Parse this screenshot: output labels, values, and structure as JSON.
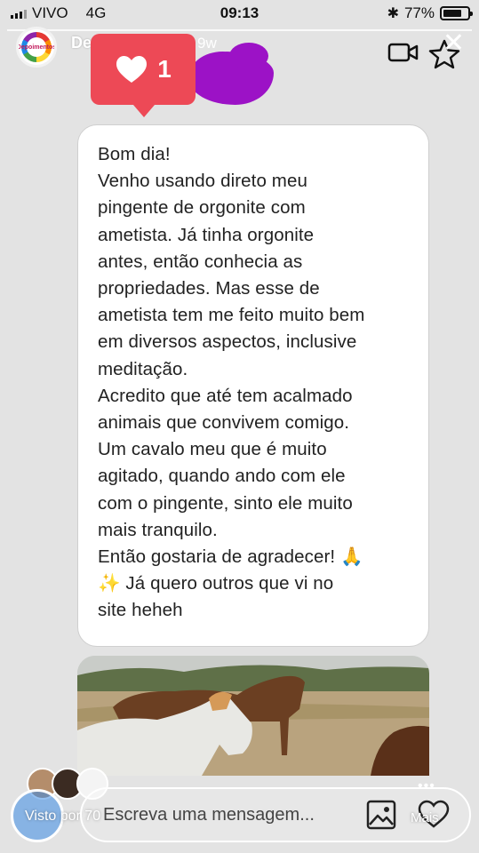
{
  "status_bar": {
    "carrier": "VIVO",
    "network": "4G",
    "time": "09:13",
    "battery": "77%",
    "battery_level": 0.77
  },
  "story": {
    "username": "Depoimentos",
    "age": "9w",
    "avatar_text": "Depoimentos",
    "likes": "1"
  },
  "message": {
    "lines": [
      "Bom dia!",
      "Venho usando direto meu",
      "pingente de orgonite com",
      "ametista. Já tinha orgonite",
      "antes, então conhecia as",
      "propriedades. Mas esse de",
      "ametista tem me feito muito bem",
      "em diversos aspectos, inclusive",
      "meditação.",
      "Acredito que até tem acalmado",
      "animais que convivem comigo.",
      "Um cavalo meu que é muito",
      "agitado, quando ando com ele",
      "com o pingente, sinto ele muito",
      "mais tranquilo.",
      "Então gostaria de agradecer! 🙏",
      "✨  Já quero outros que vi no",
      "site heheh"
    ]
  },
  "bottom_bar": {
    "seen_by": "Visto por 70",
    "placeholder": "Escreva uma mensagem...",
    "more": "Mais",
    "dots": "•••"
  },
  "colors": {
    "like_badge": "#ed4956",
    "scribble": "#9c12c6"
  },
  "icons": [
    "signal-icon",
    "bluetooth-icon",
    "battery-icon",
    "video-camera-icon",
    "star-icon",
    "close-icon",
    "heart-icon",
    "image-icon",
    "heart-outline-icon"
  ]
}
